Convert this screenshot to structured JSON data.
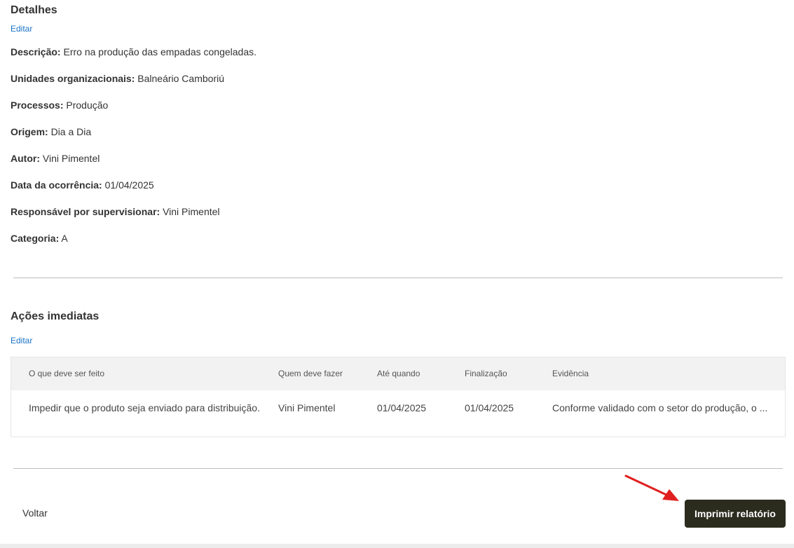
{
  "details": {
    "title": "Detalhes",
    "edit_label": "Editar",
    "rows": [
      {
        "label": "Descrição:",
        "value": "Erro na produção das empadas congeladas."
      },
      {
        "label": "Unidades organizacionais:",
        "value": "Balneário Camboriú"
      },
      {
        "label": "Processos:",
        "value": "Produção"
      },
      {
        "label": "Origem:",
        "value": "Dia a Dia"
      },
      {
        "label": "Autor:",
        "value": "Vini Pimentel"
      },
      {
        "label": "Data da ocorrência:",
        "value": "01/04/2025"
      },
      {
        "label": "Responsável por supervisionar:",
        "value": "Vini Pimentel"
      },
      {
        "label": "Categoria:",
        "value": "A"
      }
    ]
  },
  "actions": {
    "title": "Ações imediatas",
    "edit_label": "Editar",
    "columns": [
      "O que deve ser feito",
      "Quem deve fazer",
      "Até quando",
      "Finalização",
      "Evidência"
    ],
    "rows": [
      {
        "what": "Impedir que o produto seja enviado para distribuição.",
        "who": "Vini Pimentel",
        "until": "01/04/2025",
        "finished": "01/04/2025",
        "evidence": "Conforme validado com o setor do produção, o ..."
      }
    ]
  },
  "footer": {
    "back_label": "Voltar",
    "print_label": "Imprimir relatório"
  },
  "colors": {
    "link": "#1a73c8",
    "primary_button": "#2b2b1e",
    "annotation_arrow": "#e02020"
  }
}
